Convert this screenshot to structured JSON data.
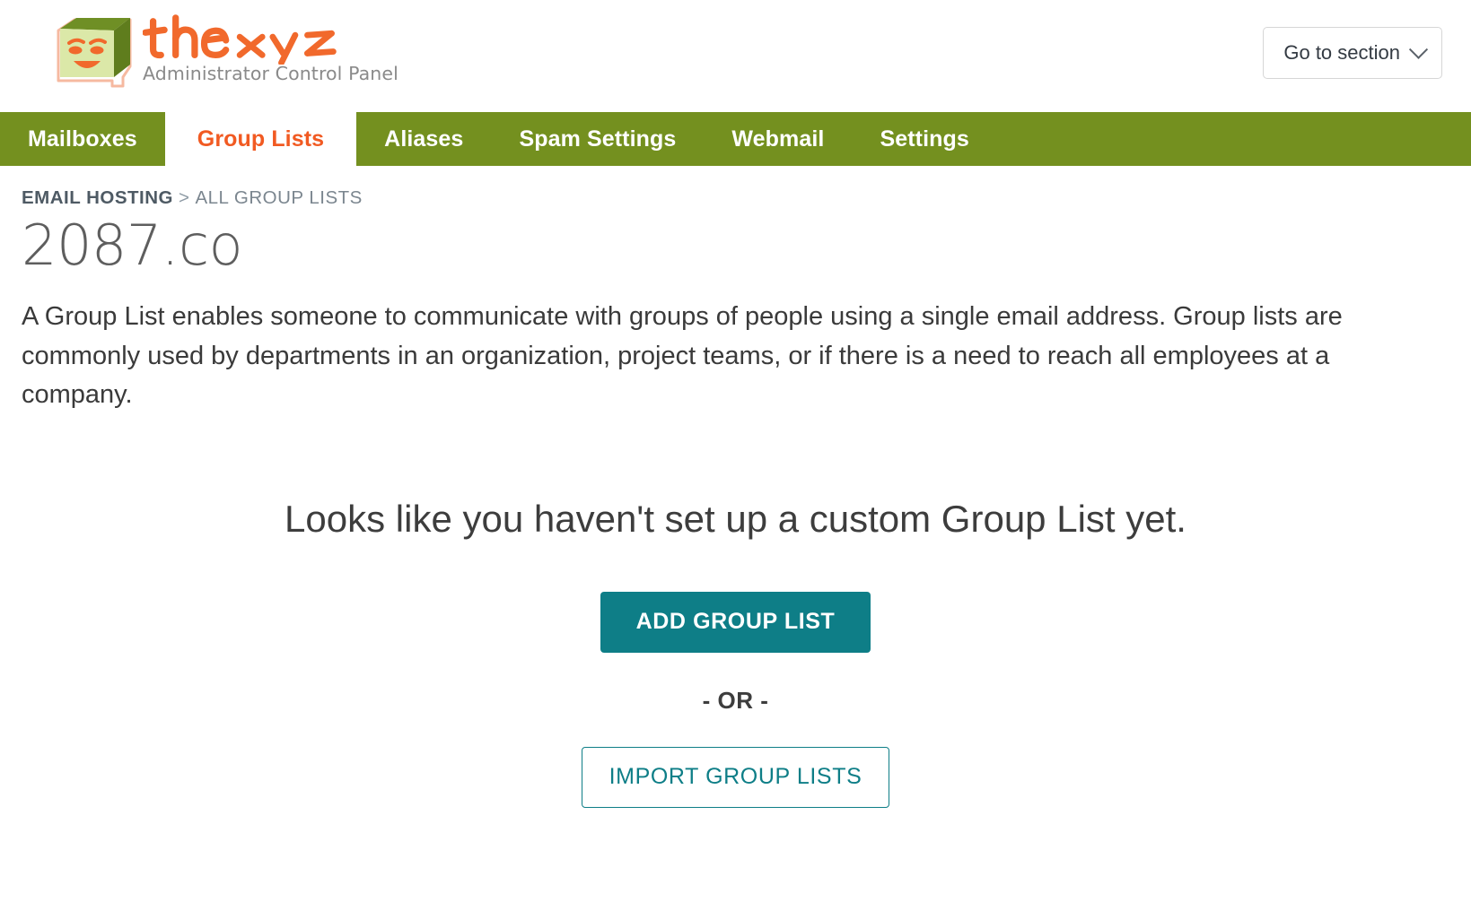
{
  "header": {
    "logo_icon": "thexyz-box-face-logo",
    "wordmark": "thexyz",
    "tagline": "Administrator Control Panel",
    "goto_section": {
      "label": "Go to section",
      "icon": "chevron-down-icon"
    }
  },
  "nav": {
    "items": [
      {
        "label": "Mailboxes",
        "active": false
      },
      {
        "label": "Group Lists",
        "active": true
      },
      {
        "label": "Aliases",
        "active": false
      },
      {
        "label": "Spam Settings",
        "active": false
      },
      {
        "label": "Webmail",
        "active": false
      },
      {
        "label": "Settings",
        "active": false
      }
    ]
  },
  "breadcrumb": {
    "root": "EMAIL HOSTING",
    "separator": ">",
    "leaf": "ALL GROUP LISTS"
  },
  "page": {
    "domain_title": "2087.co",
    "intro": "A Group List enables someone to communicate with groups of people using a single email address. Group lists are commonly used by departments in an organization, project teams, or if there is a need to reach all employees at a company."
  },
  "empty_state": {
    "heading": "Looks like you haven't set up a custom Group List yet.",
    "primary_button": "ADD GROUP LIST",
    "or_text": "- OR -",
    "secondary_button": "IMPORT GROUP LISTS"
  },
  "colors": {
    "nav_green": "#74901f",
    "active_tab_text": "#f15a22",
    "teal": "#0e7e87",
    "logo_orange": "#f1692c",
    "logo_green_light": "#dbe8a8",
    "logo_green_dark": "#6f8f25",
    "body_text": "#3a3a3a"
  }
}
